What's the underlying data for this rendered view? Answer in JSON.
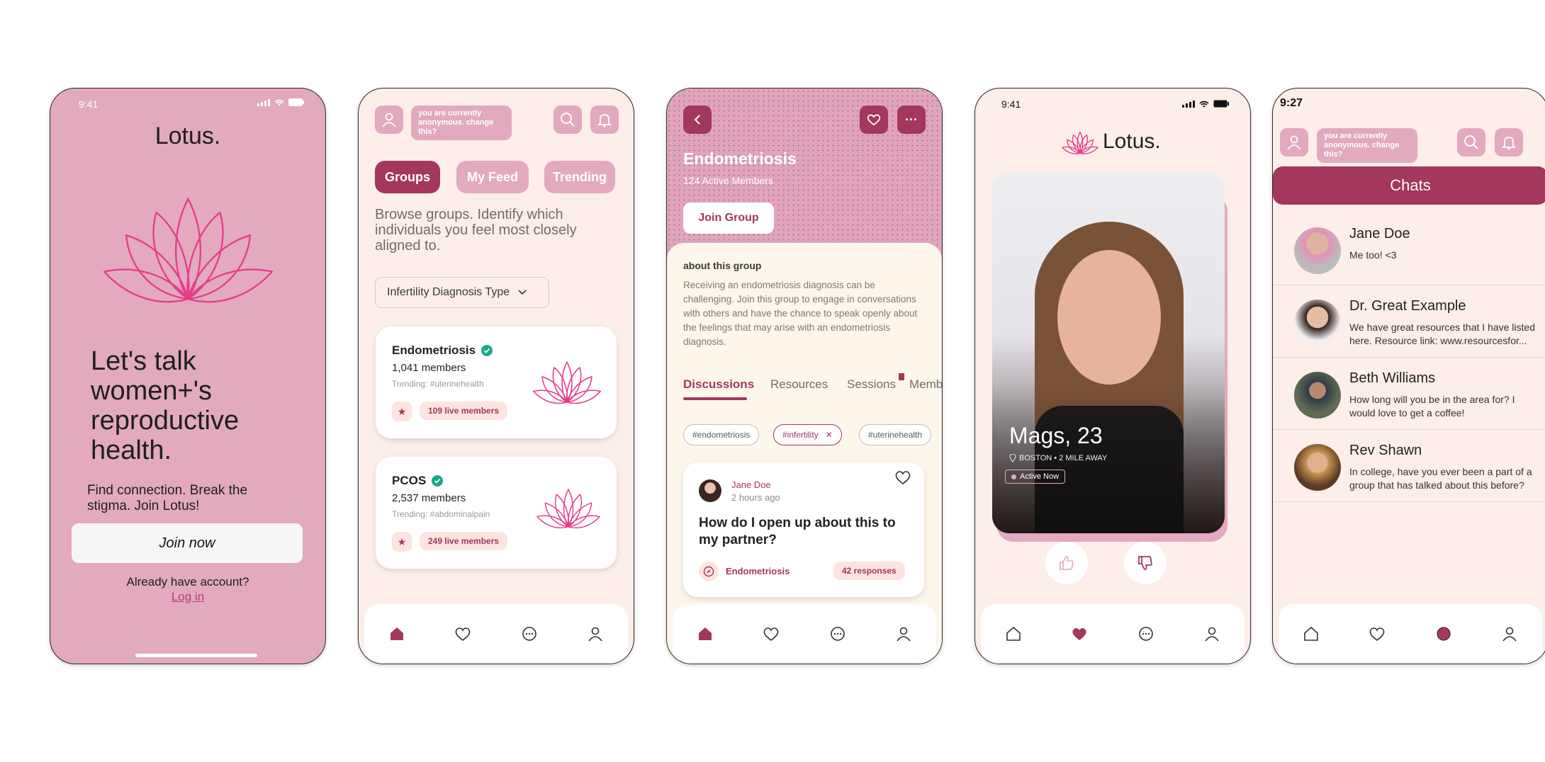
{
  "colors": {
    "brand": "#e2a9bf",
    "accent": "#a3375d",
    "cream": "#fdeee9",
    "lotus": "#e73c8a"
  },
  "screen1": {
    "time": "9:41",
    "brand": "Lotus.",
    "headline": [
      "Let's talk",
      "women+'s",
      "reproductive",
      "health."
    ],
    "subtitle": "Find connection. Break the stigma. Join Lotus!",
    "join_label": "Join now",
    "account_prompt": "Already have account?",
    "login_label": "Log in"
  },
  "screen2": {
    "anon_text": "you are currently anonymous. change this?",
    "tabs": [
      "Groups",
      "My Feed",
      "Trending"
    ],
    "intro": "Browse groups. Identify which individuals you feel most closely aligned to.",
    "filter_label": "Infertility Diagnosis Type",
    "groups": [
      {
        "name": "Endometriosis",
        "members": "1,041 members",
        "trending": "Trending: #uterinehealth",
        "live": "109 live members"
      },
      {
        "name": "PCOS",
        "members": "2,537 members",
        "trending": "Trending: #abdominalpain",
        "live": "249 live members"
      }
    ]
  },
  "screen3": {
    "group_name": "Endometriosis",
    "active_members": "124 Active Members",
    "join_label": "Join Group",
    "about_title": "about this group",
    "about_text": "Receiving an endometriosis diagnosis can be challenging. Join this group to engage in conversations with others and have the chance to speak openly about the feelings that may arise with an endometriosis diagnosis.",
    "tabs": [
      "Discussions",
      "Resources",
      "Sessions",
      "Memb"
    ],
    "tags": [
      "#endometriosis",
      "#infertility",
      "#uterinehealth"
    ],
    "post": {
      "author": "Jane Doe",
      "time": "2 hours ago",
      "title": "How do I open up about this to my partner?",
      "group": "Endometriosis",
      "responses": "42 responses"
    }
  },
  "screen4": {
    "time": "9:41",
    "brand": "Lotus.",
    "profile_name": "Mags, 23",
    "location": "BOSTON • 2 MILE AWAY",
    "status": "Active Now"
  },
  "screen5": {
    "time": "9:27",
    "anon_text": "you are currently anonymous. change this?",
    "header": "Chats",
    "chats": [
      {
        "name": "Jane Doe",
        "message": "Me too! <3"
      },
      {
        "name": "Dr. Great Example",
        "message": "We have great resources that I have listed here. Resource link: www.resourcesfor..."
      },
      {
        "name": "Beth Williams",
        "message": "How long will you be in the area for? I would love to get a coffee!"
      },
      {
        "name": "Rev Shawn",
        "message": "In college, have you ever been a part of a group that has talked about this before?"
      }
    ]
  }
}
